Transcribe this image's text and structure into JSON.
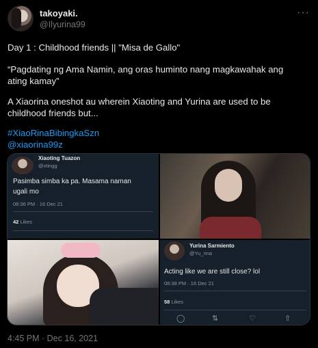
{
  "tweet": {
    "author_name": "takoyaki.",
    "author_handle": "@Ilyurina99",
    "more_label": "···",
    "lines": [
      "Day 1 : Childhood friends || \"Misa de Gallo\"",
      "“Pagdating ng Ama Namin, ang oras huminto nang magkawahak ang",
      "ating kamay”",
      "A Xiaorina oneshot au wherein Xiaoting and Yurina are used to be",
      "childhood friends but..."
    ],
    "hashtag": "#XiaoRinaBibingkaSzn",
    "mention": "@xiaorina99z",
    "timestamp": "4:45 PM · Dec 16, 2021"
  },
  "media": {
    "embedded_tweet_1": {
      "name": "Xiaoting Tuazon",
      "handle": "@xtingg",
      "body_line1": "Pasimba simba ka pa. Masama naman",
      "body_line2": "ugali mo",
      "time": "08:36 PM · 16 Dec 21",
      "likes_count": "42",
      "likes_label": "Likes"
    },
    "embedded_tweet_2": {
      "name": "Yurina Sarmiento",
      "handle": "@Yu_rina",
      "body": "Acting like we are still close? lol",
      "time": "08:38 PM · 16 Dec 21",
      "likes_count": "58",
      "likes_label": "Likes"
    },
    "icons": [
      "reply-icon",
      "retweet-icon",
      "like-icon",
      "share-icon"
    ]
  },
  "colors": {
    "background": "#000000",
    "text": "#e7e9ea",
    "secondary": "#71767b",
    "link": "#1d9bf0",
    "embedded_bg": "#15202b"
  }
}
